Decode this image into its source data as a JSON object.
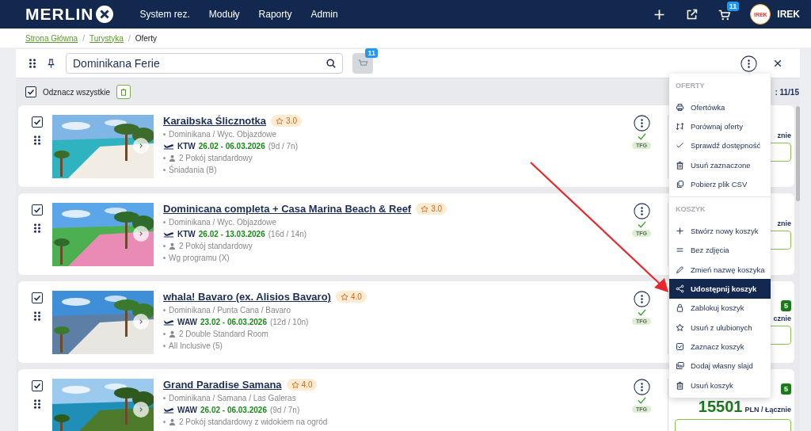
{
  "header": {
    "logo": "MERLIN",
    "nav": [
      "System rez.",
      "Moduły",
      "Raporty",
      "Admin"
    ],
    "cart_count": "11",
    "user": "IREK",
    "avatar": "IREK"
  },
  "breadcrumb": {
    "separator": "/",
    "items": [
      {
        "label": "Strona Główna",
        "link": true
      },
      {
        "label": "Turystyka",
        "link": true
      },
      {
        "label": "Oferty",
        "link": false
      }
    ]
  },
  "toolbar": {
    "search_value": "Dominikana Ferie",
    "cart_count": "11"
  },
  "select_bar": {
    "checked": true,
    "label": "Odznacz wszystkie",
    "count": ": 11/15"
  },
  "offers": [
    {
      "checked": true,
      "title": "Karaibska Ślicznotka",
      "rating": "3.0",
      "location": "Dominikana / Wyc. Objazdowe",
      "airport": "KTW",
      "dates": "26.02 - 06.03.2026",
      "duration": "(9d / 7n)",
      "room": "2 Pokój standardowy",
      "board": "Śniadania (B)",
      "tag": "TFG",
      "price_suffix": "znie"
    },
    {
      "checked": true,
      "title": "Dominicana completa + Casa Marina Beach & Reef",
      "rating": "3.0",
      "location": "Dominikana / Wyc. Objazdowe",
      "airport": "KTW",
      "dates": "26.02 - 13.03.2026",
      "duration": "(16d / 14n)",
      "room": "2 Pokój standardowy",
      "board": "Wg programu (X)",
      "tag": "TFG",
      "price_suffix": "znie"
    },
    {
      "checked": true,
      "title": "whala! Bavaro (ex. Alisios Bavaro)",
      "rating": "4.0",
      "location": "Dominikana / Punta Cana / Bavaro",
      "airport": "WAW",
      "dates": "23.02 - 06.03.2026",
      "duration": "(12d / 10n)",
      "room": "2 Double Standard Room",
      "board": "All Inclusive (5)",
      "tag": "TFG",
      "price_badge": "5",
      "price_suffix": "cznie"
    },
    {
      "checked": true,
      "title": "Grand Paradise Samana",
      "rating": "4.0",
      "location": "Dominikana / Samana / Las Galeras",
      "airport": "WAW",
      "dates": "26.02 - 06.03.2026",
      "duration": "(9d / 7n)",
      "room": "2 Pokój standardowy z widokiem na ogród",
      "tag": "TFG",
      "price": "15501",
      "price_badge": "5",
      "price_suffix": "PLN / Łącznie"
    }
  ],
  "menu": [
    {
      "kind": "header",
      "label": "OFERTY"
    },
    {
      "kind": "item",
      "label": "Ofertówka",
      "selected": false
    },
    {
      "kind": "item",
      "label": "Porównaj oferty",
      "selected": false
    },
    {
      "kind": "item",
      "label": "Sprawdź dostępność",
      "selected": false
    },
    {
      "kind": "item",
      "label": "Usuń zaznaczone",
      "selected": false
    },
    {
      "kind": "item",
      "label": "Pobierz plik CSV",
      "selected": false
    },
    {
      "kind": "divider"
    },
    {
      "kind": "header",
      "label": "KOSZYK"
    },
    {
      "kind": "item",
      "label": "Stwórz nowy koszyk",
      "selected": false
    },
    {
      "kind": "item",
      "label": "Bez zdjęcia",
      "selected": false
    },
    {
      "kind": "item",
      "label": "Zmień nazwę koszyka",
      "selected": false
    },
    {
      "kind": "item",
      "label": "Udostępnij koszyk",
      "selected": true
    },
    {
      "kind": "item",
      "label": "Zablokuj koszyk",
      "selected": false
    },
    {
      "kind": "item",
      "label": "Usuń z ulubionych",
      "selected": false
    },
    {
      "kind": "item",
      "label": "Zaznacz koszyk",
      "selected": false
    },
    {
      "kind": "item",
      "label": "Dodaj własny slajd",
      "selected": false
    },
    {
      "kind": "item",
      "label": "Usuń koszyk",
      "selected": false
    }
  ]
}
